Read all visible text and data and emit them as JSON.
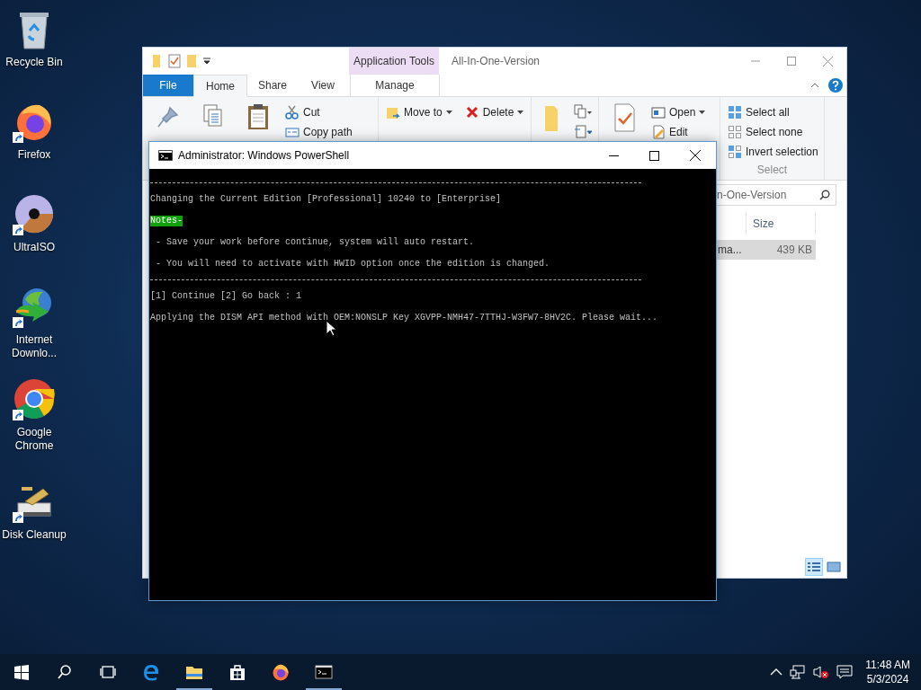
{
  "desktop_icons": [
    {
      "label": "Recycle Bin",
      "kind": "recycle",
      "shortcut": false
    },
    {
      "label": "Firefox",
      "kind": "firefox",
      "shortcut": true
    },
    {
      "label": "UltraISO",
      "kind": "disc",
      "shortcut": true
    },
    {
      "label": "Internet Downlo...",
      "kind": "globe",
      "shortcut": true
    },
    {
      "label": "Google Chrome",
      "kind": "chrome",
      "shortcut": true
    },
    {
      "label": "Disk Cleanup",
      "kind": "cleanup",
      "shortcut": true
    }
  ],
  "explorer": {
    "title": "All-In-One-Version",
    "context_group": "Application Tools",
    "tabs": [
      {
        "label": "File",
        "kind": "file",
        "selected": false
      },
      {
        "label": "Home",
        "kind": "tab",
        "selected": true
      },
      {
        "label": "Share",
        "kind": "tab",
        "selected": false
      },
      {
        "label": "View",
        "kind": "tab",
        "selected": false
      },
      {
        "label": "Manage",
        "kind": "context",
        "selected": false
      }
    ],
    "ribbon_groups": [
      {
        "kind": "clipboard",
        "items": [
          {
            "label": "Cut",
            "kind": "cut",
            "dropdown": false
          },
          {
            "label": "Copy path",
            "kind": "copypath",
            "dropdown": false
          }
        ]
      },
      {
        "kind": "organize",
        "items": [
          {
            "label": "Move to",
            "kind": "moveto",
            "dropdown": true
          },
          {
            "label": "Delete",
            "kind": "delete",
            "dropdown": true
          }
        ]
      },
      {
        "kind": "new"
      },
      {
        "kind": "open",
        "items": [
          {
            "label": "Open",
            "kind": "open",
            "dropdown": true
          },
          {
            "label": "Edit",
            "kind": "edit",
            "dropdown": false
          }
        ]
      },
      {
        "kind": "select",
        "label": "Select",
        "items": [
          {
            "label": "Select all",
            "kind": "selectall",
            "dropdown": false
          },
          {
            "label": "Select none",
            "kind": "selectnone",
            "dropdown": false
          },
          {
            "label": "Invert selection",
            "kind": "invert",
            "dropdown": false
          }
        ]
      }
    ],
    "search": {
      "placeholder": "n-One-Version"
    },
    "columns": [
      "Size"
    ],
    "rows": [
      {
        "name": "ma...",
        "size": "439 KB",
        "selected": true
      }
    ],
    "views": [
      {
        "kind": "details",
        "selected": true
      },
      {
        "kind": "large",
        "selected": false
      }
    ]
  },
  "console": {
    "title": "Administrator: Windows PowerShell",
    "lines": [
      {
        "kind": "rule"
      },
      {
        "kind": "text",
        "text": "Changing the Current Edition [Professional] 10240 to [Enterprise]"
      },
      {
        "kind": "highlight",
        "text": "Notes-"
      },
      {
        "kind": "text",
        "text": " - Save your work before continue, system will auto restart."
      },
      {
        "kind": "text",
        "text": " - You will need to activate with HWID option once the edition is changed."
      },
      {
        "kind": "rule"
      },
      {
        "kind": "text",
        "text": "[1] Continue [2] Go back : 1"
      },
      {
        "kind": "text",
        "text": "Applying the DISM API method with OEM:NONSLP Key XGVPP-NMH47-7TTHJ-W3FW7-8HV2C. Please wait..."
      }
    ]
  },
  "taskbar": {
    "items": [
      {
        "kind": "start",
        "running": false
      },
      {
        "kind": "search",
        "running": false
      },
      {
        "kind": "taskview",
        "running": false
      },
      {
        "kind": "edge",
        "running": false
      },
      {
        "kind": "explorer",
        "running": true
      },
      {
        "kind": "store",
        "running": false
      },
      {
        "kind": "firefox",
        "running": false
      },
      {
        "kind": "terminal",
        "running": true
      }
    ],
    "time": "11:48 AM",
    "date": "5/3/2024"
  }
}
